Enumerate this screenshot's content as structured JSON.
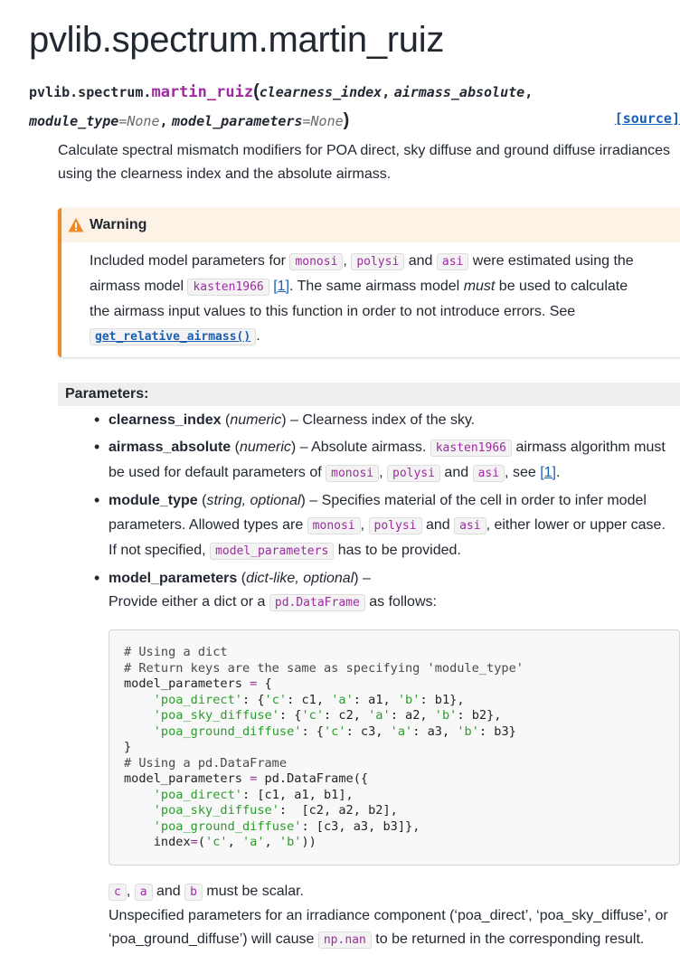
{
  "title": "pvlib.spectrum.martin_ruiz",
  "signature": {
    "module": "pvlib.spectrum.",
    "name": "martin_ruiz",
    "open_paren": "(",
    "close_paren": ")",
    "arg1": "clearness_index",
    "arg2": "airmass_absolute",
    "arg3": "module_type",
    "arg3_default": "None",
    "arg4": "model_parameters",
    "arg4_default": "None",
    "equals": "=",
    "comma": ",",
    "source_link": "[source]"
  },
  "description": "Calculate spectral mismatch modifiers for POA direct, sky diffuse and ground diffuse irradiances using the clearness index and the absolute airmass.",
  "warning": {
    "title": "Warning",
    "t1": "Included model parameters for ",
    "c1": "monosi",
    "t2": ", ",
    "c2": "polysi",
    "t3": " and ",
    "c3": "asi",
    "t4": " were estimated using the airmass model ",
    "c4": "kasten1966",
    "t5": " ",
    "ref": "[1]",
    "t6": ". The same airmass model ",
    "em": "must",
    "t7": " be used to calculate the airmass input values to this function in order to not introduce errors. See ",
    "xref": "get_relative_airmass()",
    "t8": "."
  },
  "parameters_label": "Parameters:",
  "params": {
    "p1": {
      "name": "clearness_index",
      "open": " (",
      "type": "numeric",
      "close": ")",
      "desc": " – Clearness index of the sky."
    },
    "p2": {
      "name": "airmass_absolute",
      "open": " (",
      "type": "numeric",
      "close": ")",
      "d1": " – Absolute airmass. ",
      "c1": "kasten1966",
      "d2": " airmass algorithm must be used for default parameters of ",
      "c2": "monosi",
      "d3": ", ",
      "c3": "polysi",
      "d4": " and ",
      "c4": "asi",
      "d5": ", see ",
      "ref": "[1]",
      "d6": "."
    },
    "p3": {
      "name": "module_type",
      "open": " (",
      "type": "string, optional",
      "close": ")",
      "d1": " – Specifies material of the cell in order to infer model parameters. Allowed types are ",
      "c1": "monosi",
      "d2": ", ",
      "c2": "polysi",
      "d3": " and ",
      "c3": "asi",
      "d4": ", either lower or upper case. If not specified, ",
      "c4": "model_parameters",
      "d5": " has to be provided."
    },
    "p4": {
      "name": "model_parameters",
      "open": " (",
      "type": "dict-like, optional",
      "close": ")",
      "desc": " –"
    }
  },
  "provide": {
    "t1": "Provide either a dict or a ",
    "c1": "pd.DataFrame",
    "t2": " as follows:"
  },
  "code_lines": [
    "# Using a dict",
    "# Return keys are the same as specifying 'module_type'",
    "model_parameters = {",
    "    'poa_direct': {'c': c1, 'a': a1, 'b': b1},",
    "    'poa_sky_diffuse': {'c': c2, 'a': a2, 'b': b2},",
    "    'poa_ground_diffuse': {'c': c3, 'a': a3, 'b': b3}",
    "}",
    "# Using a pd.DataFrame",
    "model_parameters = pd.DataFrame({",
    "    'poa_direct': [c1, a1, b1],",
    "    'poa_sky_diffuse':  [c2, a2, b2],",
    "    'poa_ground_diffuse': [c3, a3, b3]},",
    "    index=('c', 'a', 'b'))"
  ],
  "scalar": {
    "c1": "c",
    "t1": ", ",
    "c2": "a",
    "t2": " and ",
    "c3": "b",
    "t3": " must be scalar."
  },
  "unspecified": {
    "t1": "Unspecified parameters for an irradiance component (‘poa_direct’, ‘poa_sky_diffuse’, or ‘poa_ground_diffuse’) will cause ",
    "c1": "np.nan",
    "t2": " to be returned in the corresponding result."
  }
}
